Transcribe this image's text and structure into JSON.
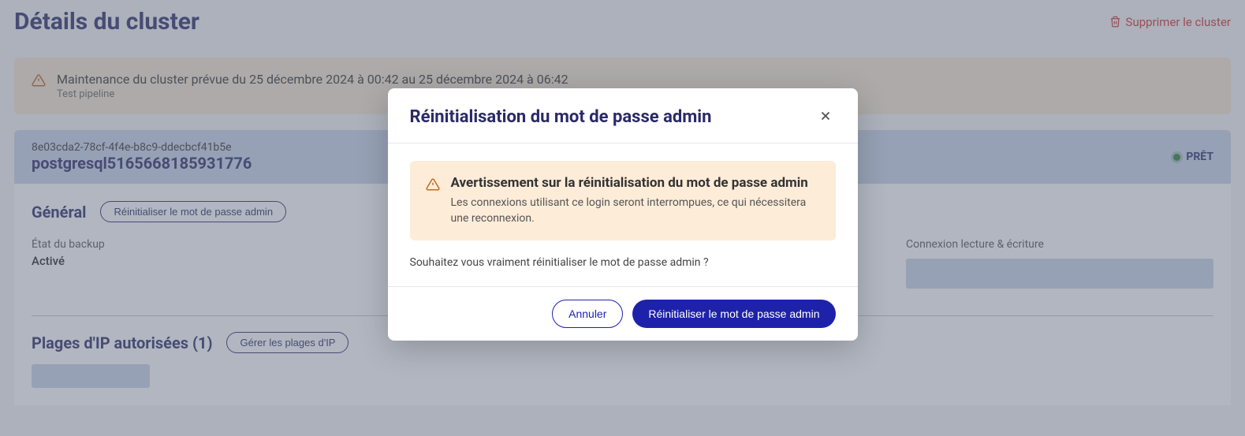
{
  "header": {
    "title": "Détails du cluster",
    "delete_label": "Supprimer le cluster"
  },
  "maintenance": {
    "main": "Maintenance du cluster prévue du 25 décembre 2024 à 00:42 au 25 décembre 2024 à 06:42",
    "sub": "Test pipeline"
  },
  "cluster": {
    "id": "8e03cda2-78cf-4f4e-b8c9-ddecbcf41b5e",
    "name": "postgresql5165668185931776",
    "status": "PRÊT"
  },
  "general": {
    "section_title": "Général",
    "reset_button": "Réinitialiser le mot de passe admin",
    "backup_label": "État du backup",
    "backup_value": "Activé",
    "rw_label": "Connexion lecture & écriture"
  },
  "ip": {
    "title": "Plages d'IP autorisées (1)",
    "manage_button": "Gérer les plages d'IP"
  },
  "modal": {
    "title": "Réinitialisation du mot de passe admin",
    "warning_title": "Avertissement sur la réinitialisation du mot de passe admin",
    "warning_text": "Les connexions utilisant ce login seront interrompues, ce qui nécessitera une reconnexion.",
    "question": "Souhaitez vous vraiment réinitialiser le mot de passe admin ?",
    "cancel": "Annuler",
    "confirm": "Réinitialiser le mot de passe admin"
  }
}
